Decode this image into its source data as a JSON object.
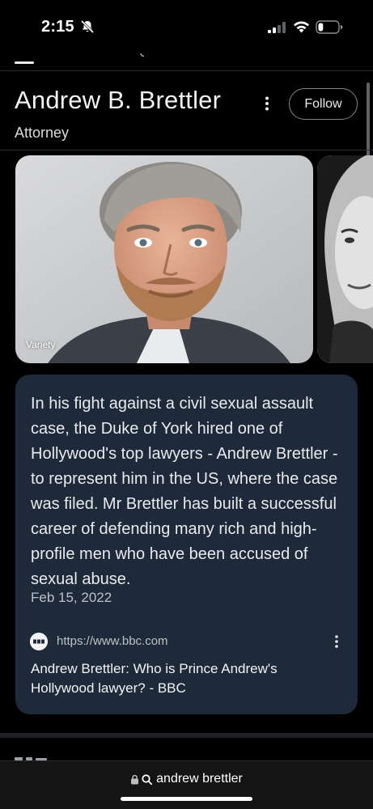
{
  "status_bar": {
    "time": "2:15",
    "bell_icon": "bell-slash-icon",
    "signal_icon": "cellular-signal-icon",
    "wifi_icon": "wifi-icon",
    "battery_icon": "battery-icon",
    "battery_level": 0.25
  },
  "header": {
    "menu_icon": "menu-icon"
  },
  "entity": {
    "title": "Andrew B. Brettler",
    "subtitle": "Attorney",
    "more_icon": "more-vert-icon",
    "follow_label": "Follow"
  },
  "images": [
    {
      "source": "Variety",
      "kind": "portrait-photo"
    },
    {
      "source": "",
      "kind": "black-and-white-portrait-photo"
    }
  ],
  "news": {
    "snippet": "In his fight against a civil sexual assault case, the Duke of York hired one of Hollywood's top lawyers - Andrew Brettler - to represent him in the US, where the case was filed. Mr Brettler has built a successful career of defending many rich and high-profile men who have been accused of sexual abuse.",
    "date": "Feb 15, 2022",
    "source_url": "https://www.bbc.com",
    "source_icon": "bbc-favicon-icon",
    "more_icon": "more-vert-icon",
    "headline": "Andrew Brettler: Who is Prince Andrew's Hollywood lawyer? - BBC"
  },
  "address_bar": {
    "lock_icon": "lock-icon",
    "search_icon": "search-icon",
    "query": "andrew brettler"
  },
  "colors": {
    "background": "#000000",
    "card": "#1e2a3a",
    "text": "#e8eaed",
    "muted": "#bdc1c6"
  }
}
